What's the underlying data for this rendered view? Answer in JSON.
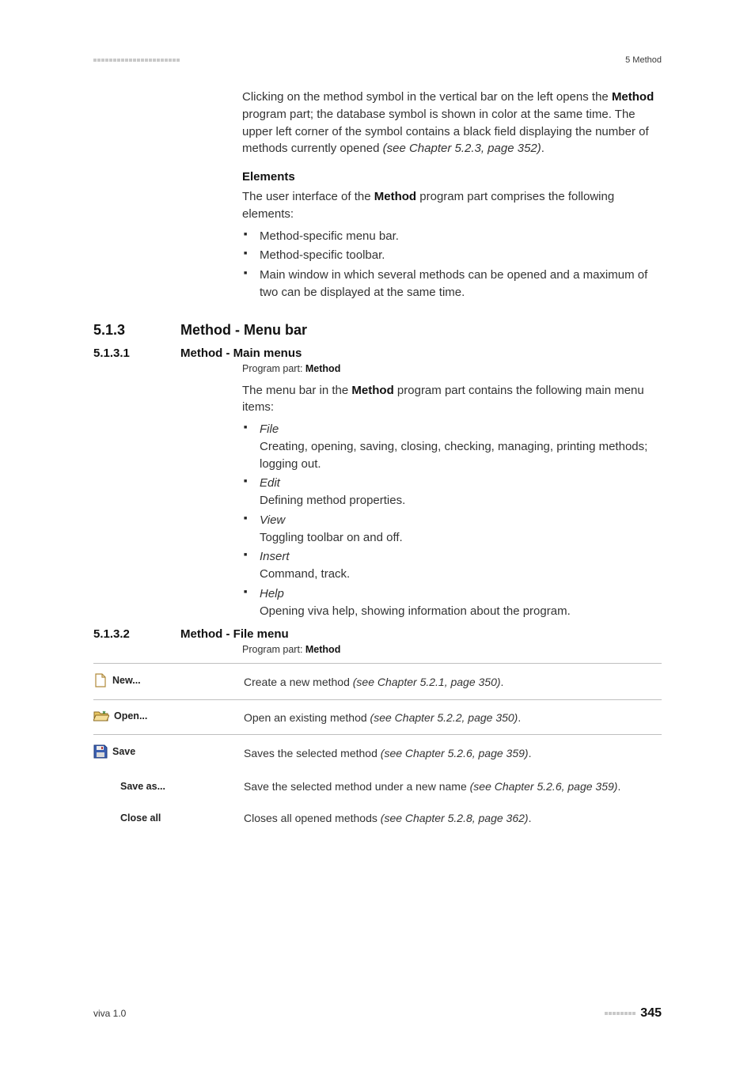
{
  "header": {
    "right": "5 Method"
  },
  "intro": {
    "t1": "Clicking on the method symbol in the vertical bar on the left opens the ",
    "t2_bold": "Method",
    "t3": " program part; the database symbol is shown in color at the same time. The upper left corner of the symbol contains a black field displaying the number of methods currently opened ",
    "t4_italic": "(see Chapter 5.2.3, page 352)",
    "t5": "."
  },
  "elements": {
    "heading": "Elements",
    "lead1": "The user interface of the ",
    "lead_bold": "Method",
    "lead2": " program part comprises the following elements:",
    "items": [
      "Method-specific menu bar.",
      "Method-specific toolbar.",
      "Main window in which several methods can be opened and a maximum of two can be displayed at the same time."
    ]
  },
  "sec513": {
    "num": "5.1.3",
    "title": "Method - Menu bar"
  },
  "sec5131": {
    "num": "5.1.3.1",
    "title": "Method - Main menus",
    "program_part_label": "Program part: ",
    "program_part_value": "Method",
    "lead1": "The menu bar in the ",
    "lead_bold": "Method",
    "lead2": " program part contains the following main menu items:",
    "items": [
      {
        "name": "File",
        "desc": "Creating, opening, saving, closing, checking, managing, printing methods; logging out."
      },
      {
        "name": "Edit",
        "desc": "Defining method properties."
      },
      {
        "name": "View",
        "desc": "Toggling toolbar on and off."
      },
      {
        "name": "Insert",
        "desc": "Command, track."
      },
      {
        "name": "Help",
        "desc": "Opening viva help, showing information about the program."
      }
    ]
  },
  "sec5132": {
    "num": "5.1.3.2",
    "title": "Method - File menu",
    "program_part_label": "Program part: ",
    "program_part_value": "Method",
    "rows": [
      {
        "cmd": "New...",
        "desc": "Create a new method ",
        "ref": "(see Chapter 5.2.1, page 350)",
        "dot": "."
      },
      {
        "cmd": "Open...",
        "desc": "Open an existing method ",
        "ref": "(see Chapter 5.2.2, page 350)",
        "dot": "."
      },
      {
        "cmd": "Save",
        "desc": "Saves the selected method ",
        "ref": "(see Chapter 5.2.6, page 359)",
        "dot": "."
      },
      {
        "cmd": "Save as...",
        "desc": "Save the selected method under a new name ",
        "ref": "(see Chapter 5.2.6, page 359)",
        "dot": "."
      },
      {
        "cmd": "Close all",
        "desc": "Closes all opened methods ",
        "ref": "(see Chapter 5.2.8, page 362)",
        "dot": "."
      }
    ]
  },
  "footer": {
    "left": "viva 1.0",
    "page": "345"
  }
}
